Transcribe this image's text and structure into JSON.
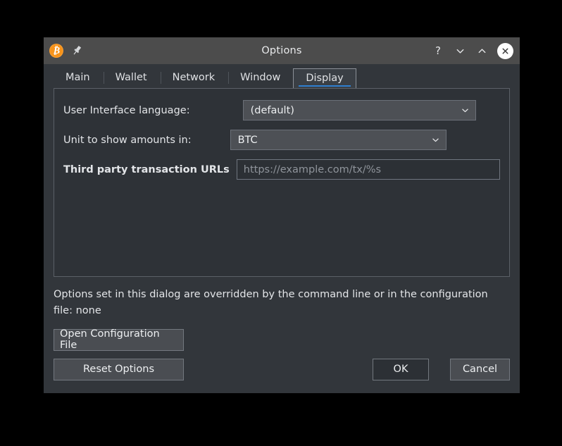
{
  "window": {
    "title": "Options",
    "logo_icon": "bitcoin-logo-icon",
    "pin_icon": "pin-icon",
    "controls": {
      "help_label": "?",
      "minimize_icon": "chevron-down-icon",
      "maximize_icon": "chevron-up-icon",
      "close_icon": "close-icon"
    }
  },
  "tabs": [
    {
      "label": "Main",
      "selected": false
    },
    {
      "label": "Wallet",
      "selected": false
    },
    {
      "label": "Network",
      "selected": false
    },
    {
      "label": "Window",
      "selected": false
    },
    {
      "label": "Display",
      "selected": true
    }
  ],
  "form": {
    "language": {
      "label": "User Interface language:",
      "value": "(default)",
      "chevron_icon": "chevron-down-icon"
    },
    "unit": {
      "label": "Unit to show amounts in:",
      "value": "BTC",
      "chevron_icon": "chevron-down-icon"
    },
    "third_party_urls": {
      "label": "Third party transaction URLs",
      "value": "",
      "placeholder": "https://example.com/tx/%s"
    }
  },
  "footer": {
    "override_notice": "Options set in this dialog are overridden by the command line or in the configuration file: none",
    "open_config_label": "Open Configuration File",
    "reset_label": "Reset Options",
    "ok_label": "OK",
    "cancel_label": "Cancel"
  },
  "colors": {
    "accent": "#2f7fd1",
    "brand_orange": "#f7931a",
    "titlebar": "#4c4c4c",
    "dialog_bg": "#32363b",
    "panel_bg": "#2e3237"
  }
}
